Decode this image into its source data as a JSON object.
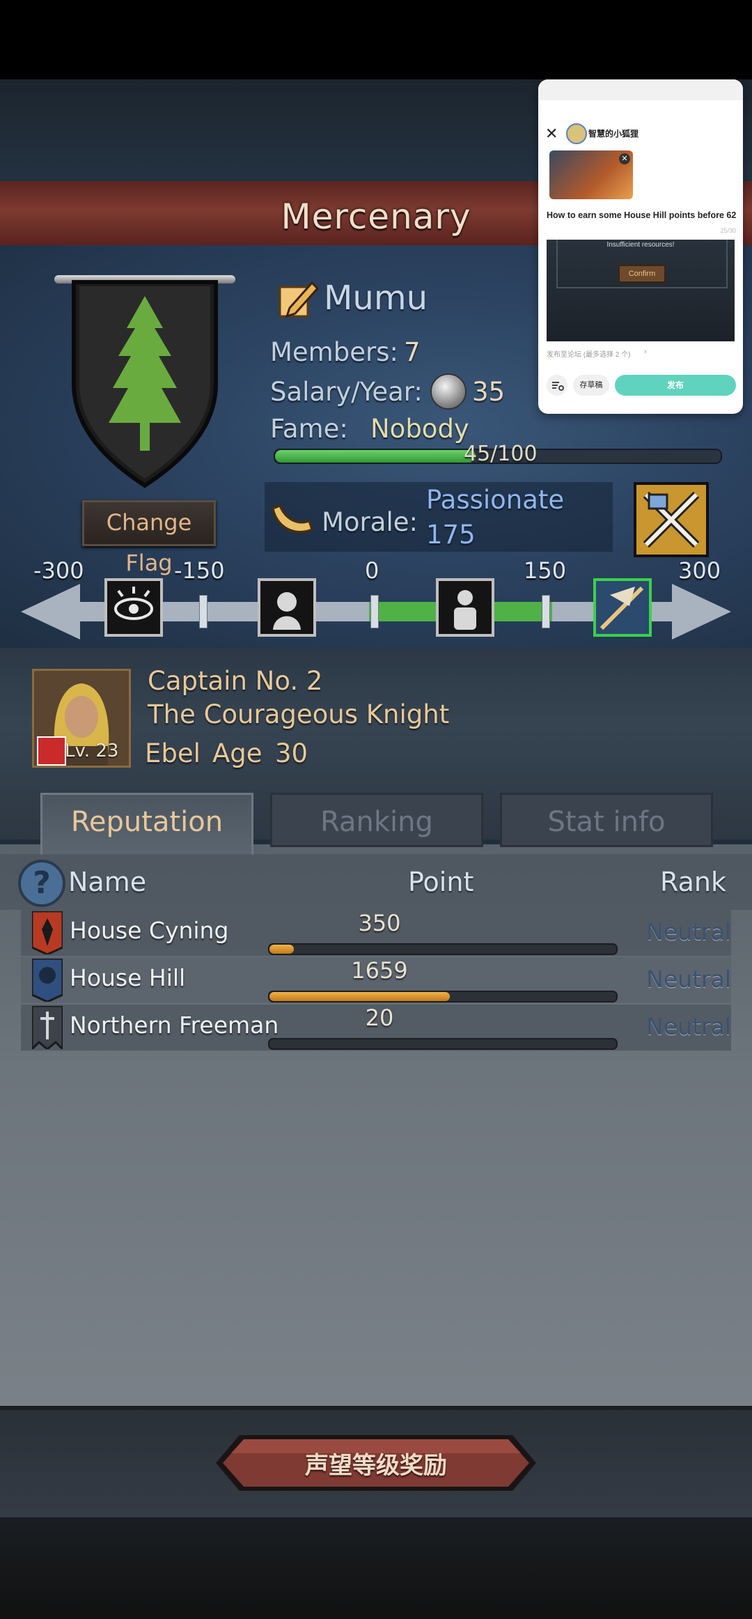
{
  "header": {
    "title": "Mercenary"
  },
  "mercenary": {
    "name": "Mumu",
    "members_label": "Members:",
    "members_value": "7",
    "salary_label": "Salary/Year:",
    "salary_value": "35",
    "fame_label": "Fame:",
    "fame_value": "Nobody",
    "fame_progress_text": "45/100",
    "fame_progress_fraction": 0.45,
    "change_flag_label": "Change Flag",
    "morale_label": "Morale:",
    "morale_state": "Passionate",
    "morale_value": "175"
  },
  "morale_scale": {
    "ticks": [
      "-300",
      "-150",
      "0",
      "150",
      "300"
    ],
    "icons": [
      "eye-icon",
      "despair-icon",
      "neutral-figure-icon",
      "passionate-icon"
    ],
    "current": 175,
    "min": -300,
    "max": 300
  },
  "captain": {
    "title": "Captain No. 2",
    "epithet": "The Courageous Knight",
    "name": "Ebel",
    "age_label": "Age",
    "age_value": "30",
    "level": "Lv. 23"
  },
  "tabs": [
    {
      "label": "Reputation",
      "active": true
    },
    {
      "label": "Ranking",
      "active": false
    },
    {
      "label": "Stat info",
      "active": false
    }
  ],
  "table": {
    "headers": {
      "name": "Name",
      "point": "Point",
      "rank": "Rank"
    },
    "rows": [
      {
        "name": "House Cyning",
        "point": "350",
        "fill": 0.07,
        "rank": "Neutral",
        "color": "#b83a23"
      },
      {
        "name": "House Hill",
        "point": "1659",
        "fill": 0.52,
        "rank": "Neutral",
        "color": "#2f4f7e"
      },
      {
        "name": "Northern Freeman",
        "point": "20",
        "fill": 0.0,
        "rank": "Neutral",
        "color": "#3d434a"
      }
    ]
  },
  "reward_button": {
    "label": "声望等级奖励"
  },
  "overlay": {
    "username": "智慧的小狐狸",
    "post_title": "How to earn some House Hill points before 62",
    "char_count": "25/30",
    "image_text_1": "Insufficient resources!",
    "image_button": "Confirm",
    "forum_link": "发布至论坛 (最多选择 2 个)",
    "save_draft": "存草稿",
    "publish": "发布"
  },
  "colors": {
    "banner": "#6b2c26",
    "accent_gold": "#e9c896",
    "morale_blue": "#8fb6f0",
    "fame_green": "#4fb146",
    "publish_teal": "#5fd3bd"
  }
}
